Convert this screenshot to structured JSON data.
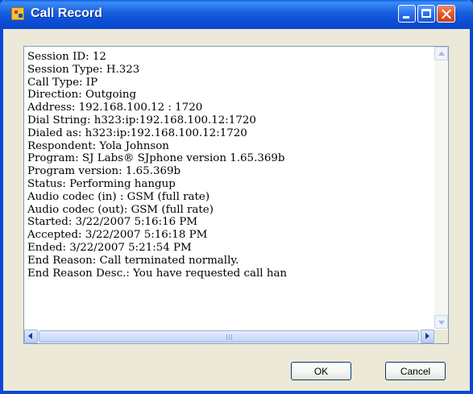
{
  "window": {
    "title": "Call Record"
  },
  "title_icon": "app-icon",
  "log": {
    "lines": [
      "Session ID: 12",
      "Session Type: H.323",
      "Call Type: IP",
      "Direction: Outgoing",
      "Address: 192.168.100.12 : 1720",
      "Dial String: h323:ip:192.168.100.12:1720",
      "Dialed as: h323:ip:192.168.100.12:1720",
      "Respondent: Yola Johnson",
      "Program: SJ Labs® SJphone version 1.65.369b",
      "Program version: 1.65.369b",
      "Status: Performing hangup",
      "Audio codec (in) : GSM (full rate)",
      "Audio codec (out): GSM (full rate)",
      "Started: 3/22/2007 5:16:16 PM",
      "Accepted: 3/22/2007 5:16:18 PM",
      "Ended: 3/22/2007 5:21:54 PM",
      "End Reason: Call terminated normally.",
      "End Reason Desc.: You have requested call han"
    ]
  },
  "buttons": {
    "ok": "OK",
    "cancel": "Cancel"
  },
  "colors": {
    "titlebar": "#0b4fd6",
    "window_bg": "#ece9d8",
    "close": "#e35a2b"
  }
}
